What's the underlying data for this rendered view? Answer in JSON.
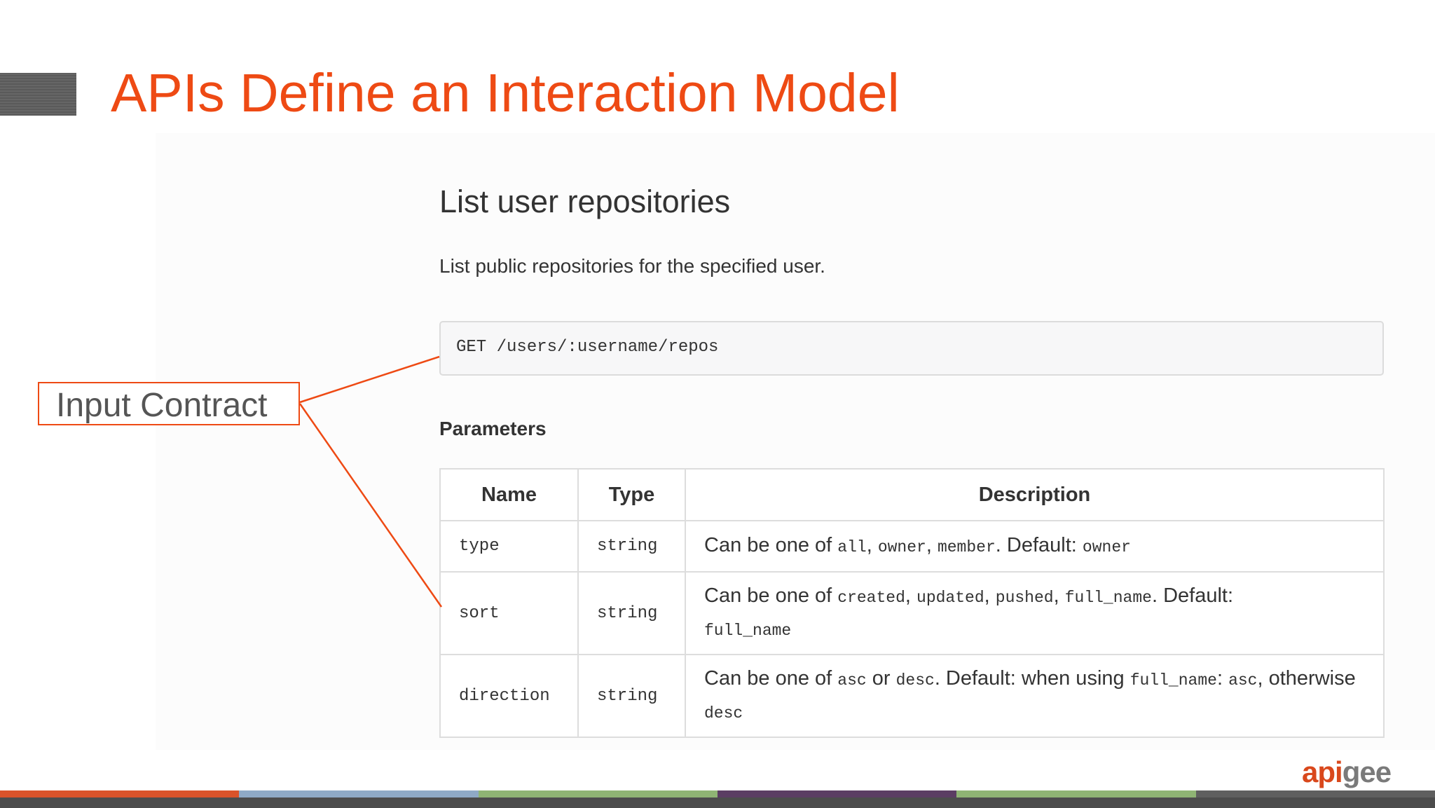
{
  "slide": {
    "title": "APIs Define an Interaction Model",
    "callout_label": "Input Contract"
  },
  "doc": {
    "title": "List user repositories",
    "description": "List public repositories for the specified user.",
    "endpoint": "GET /users/:username/repos",
    "params_heading": "Parameters",
    "table": {
      "headers": [
        "Name",
        "Type",
        "Description"
      ],
      "rows": [
        {
          "name": "type",
          "type": "string",
          "desc": {
            "p1": "Can be one of ",
            "c1": "all",
            "s1": ", ",
            "c2": "owner",
            "s2": ", ",
            "c3": "member",
            "p2": ". Default: ",
            "c4": "owner"
          }
        },
        {
          "name": "sort",
          "type": "string",
          "desc": {
            "p1": "Can be one of ",
            "c1": "created",
            "s1": ", ",
            "c2": "updated",
            "s2": ", ",
            "c3": "pushed",
            "s3": ", ",
            "c4": "full_name",
            "p2": ". Default: ",
            "c5": "full_name"
          }
        },
        {
          "name": "direction",
          "type": "string",
          "desc": {
            "p1": "Can be one of ",
            "c1": "asc",
            "s1": " or ",
            "c2": "desc",
            "p2": ". Default: when using ",
            "c3": "full_name",
            "s2": ": ",
            "c4": "asc",
            "p3": ", otherwise ",
            "c5": "desc"
          }
        }
      ]
    }
  },
  "logo": {
    "prefix": "api",
    "rest": "gee"
  },
  "colors": {
    "accent": "#ee4a14",
    "footer_stripes": [
      "#d9532a",
      "#8fa9c6",
      "#8fb474",
      "#5b3d63",
      "#8fb474",
      "#5f5f5f"
    ]
  }
}
